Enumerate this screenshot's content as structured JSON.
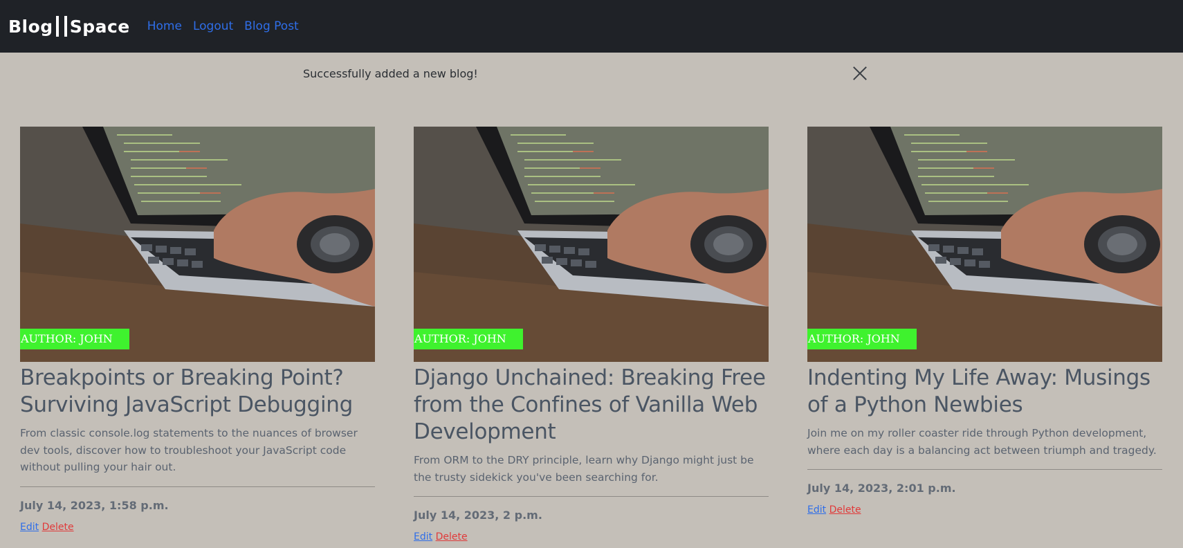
{
  "navbar": {
    "brand": {
      "part1": "Blog",
      "part2": "Space"
    },
    "links": [
      "Home",
      "Logout",
      "Blog Post"
    ]
  },
  "alert": {
    "message": "Successfully added a new blog!"
  },
  "posts": [
    {
      "author": "AUTHOR: JOHN",
      "title": "Breakpoints or Breaking Point? Surviving JavaScript Debugging",
      "description": "From classic console.log statements to the nuances of browser dev tools, discover how to troubleshoot your JavaScript code without pulling your hair out.",
      "date": "July 14, 2023, 1:58 p.m.",
      "edit_label": "Edit",
      "delete_label": "Delete"
    },
    {
      "author": "AUTHOR: JOHN",
      "title": "Django Unchained: Breaking Free from the Confines of Vanilla Web Development",
      "description": "From ORM to the DRY principle, learn why Django might just be the trusty sidekick you've been searching for.",
      "date": "July 14, 2023, 2 p.m.",
      "edit_label": "Edit",
      "delete_label": "Delete"
    },
    {
      "author": "AUTHOR: JOHN",
      "title": "Indenting My Life Away: Musings of a Python Newbies",
      "description": "Join me on my roller coaster ride through Python development, where each day is a balancing act between triumph and tragedy.",
      "date": "July 14, 2023, 2:01 p.m.",
      "edit_label": "Edit",
      "delete_label": "Delete"
    }
  ],
  "colors": {
    "navbar_bg": "#1f2227",
    "page_bg": "#c4bfb8",
    "link": "#2f6ee8",
    "delete": "#e03a3a",
    "author_badge": "#3ff22e"
  },
  "icons": [
    "close-icon",
    "laptop-photo"
  ]
}
